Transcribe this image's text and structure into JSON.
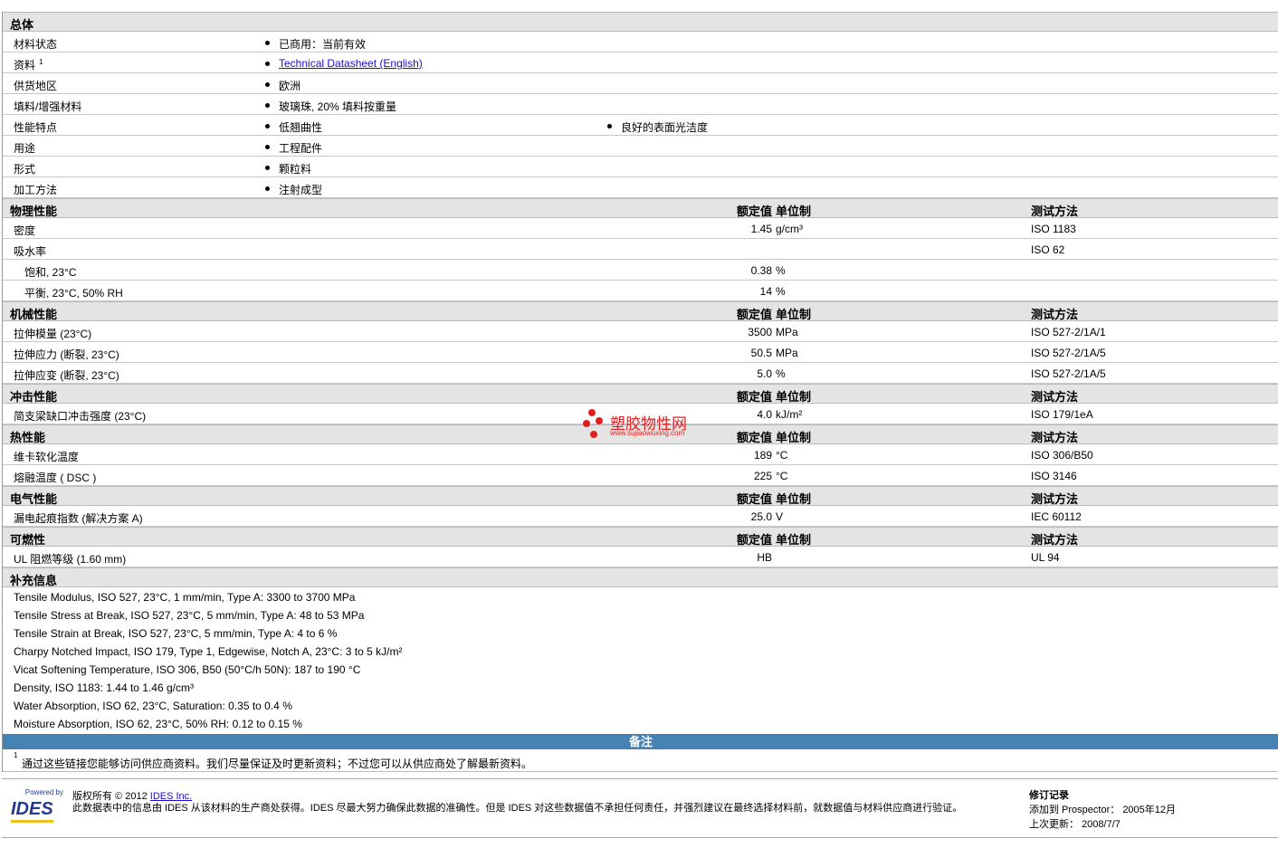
{
  "general": {
    "title": "总体",
    "rows": [
      {
        "label": "材料状态",
        "values": [
          "已商用：当前有效"
        ]
      },
      {
        "label": "资料",
        "sup": "1",
        "values": [
          "Technical Datasheet (English)"
        ],
        "link": true
      },
      {
        "label": "供货地区",
        "values": [
          "欧洲"
        ]
      },
      {
        "label": "填料/增强材料",
        "values": [
          "玻璃珠, 20% 填料按重量"
        ]
      },
      {
        "label": "性能特点",
        "values": [
          "低翘曲性",
          "良好的表面光洁度"
        ]
      },
      {
        "label": "用途",
        "values": [
          "工程配件"
        ]
      },
      {
        "label": "形式",
        "values": [
          "颗粒料"
        ]
      },
      {
        "label": "加工方法",
        "values": [
          "注射成型"
        ]
      }
    ]
  },
  "col_headers": {
    "value": "额定值",
    "unit": "单位制",
    "method": "测试方法"
  },
  "sections": [
    {
      "title": "物理性能",
      "rows": [
        {
          "label": "密度",
          "value": "1.45",
          "unit": "g/cm³",
          "method": "ISO 1183"
        },
        {
          "label": "吸水率",
          "value": "",
          "unit": "",
          "method": "ISO 62"
        },
        {
          "label": "饱和, 23°C",
          "value": "0.38",
          "unit": "%",
          "method": "",
          "indent": true
        },
        {
          "label": "平衡, 23°C, 50% RH",
          "value": "14",
          "unit": "%",
          "method": "",
          "indent": true
        }
      ]
    },
    {
      "title": "机械性能",
      "rows": [
        {
          "label": "拉伸模量 (23°C)",
          "value": "3500",
          "unit": "MPa",
          "method": "ISO 527-2/1A/1"
        },
        {
          "label": "拉伸应力 (断裂, 23°C)",
          "value": "50.5",
          "unit": "MPa",
          "method": "ISO 527-2/1A/5"
        },
        {
          "label": "拉伸应变 (断裂, 23°C)",
          "value": "5.0",
          "unit": "%",
          "method": "ISO 527-2/1A/5"
        }
      ]
    },
    {
      "title": "冲击性能",
      "rows": [
        {
          "label": "简支梁缺口冲击强度 (23°C)",
          "value": "4.0",
          "unit": "kJ/m²",
          "method": "ISO 179/1eA"
        }
      ]
    },
    {
      "title": "热性能",
      "rows": [
        {
          "label": "维卡软化温度",
          "value": "189",
          "unit": "°C",
          "method": "ISO 306/B50"
        },
        {
          "label": "熔融温度 ( DSC )",
          "value": "225",
          "unit": "°C",
          "method": "ISO 3146"
        }
      ]
    },
    {
      "title": "电气性能",
      "rows": [
        {
          "label": "漏电起痕指数 (解决方案 A)",
          "value": "25.0",
          "unit": "V",
          "method": "IEC 60112"
        }
      ]
    },
    {
      "title": "可燃性",
      "rows": [
        {
          "label": "UL 阻燃等级 (1.60 mm)",
          "value": "HB",
          "unit": "",
          "method": "UL 94"
        }
      ]
    }
  ],
  "supplementary": {
    "title": "补充信息",
    "lines": [
      "Tensile Modulus, ISO 527, 23°C, 1 mm/min, Type A: 3300 to 3700 MPa",
      "Tensile Stress at Break, ISO 527, 23°C, 5 mm/min, Type A: 48 to 53 MPa",
      "Tensile Strain at Break, ISO 527, 23°C, 5 mm/min, Type A: 4 to 6 %",
      "Charpy Notched Impact, ISO 179, Type 1, Edgewise, Notch A, 23°C: 3 to 5 kJ/m²",
      "Vicat Softening Temperature, ISO 306, B50 (50°C/h 50N): 187 to 190 °C",
      "Density, ISO 1183: 1.44 to 1.46 g/cm³",
      "Water Absorption, ISO 62, 23°C, Saturation: 0.35 to 0.4 %",
      "Moisture Absorption, ISO 62, 23°C, 50% RH: 0.12 to 0.15 %"
    ]
  },
  "notes": {
    "title": "备注",
    "sup": "1",
    "text": "通过这些链接您能够访问供应商资料。我们尽量保证及时更新资料；不过您可以从供应商处了解最新资料。"
  },
  "watermark": {
    "name": "塑胶物性网",
    "url": "www.sujiaowuxing.com"
  },
  "footer": {
    "logo_small": "Powered by",
    "logo": "IDES",
    "copyright": "版权所有 © 2012",
    "company_link": "IDES Inc.",
    "disclaimer": "此数据表中的信息由 IDES 从该材料的生产商处获得。IDES 尽最大努力确保此数据的准确性。但是 IDES 对这些数据值不承担任何责任，并强烈建议在最终选择材料前，就数据值与材料供应商进行验证。",
    "revision_title": "修订记录",
    "added_label": "添加到 Prospector：",
    "added_value": "2005年12月",
    "updated_label": "上次更新：",
    "updated_value": "2008/7/7"
  },
  "colors": {
    "header_bg": "#e4e4e4",
    "notes_bar": "#4682b4",
    "link": "#1a0dcc"
  }
}
